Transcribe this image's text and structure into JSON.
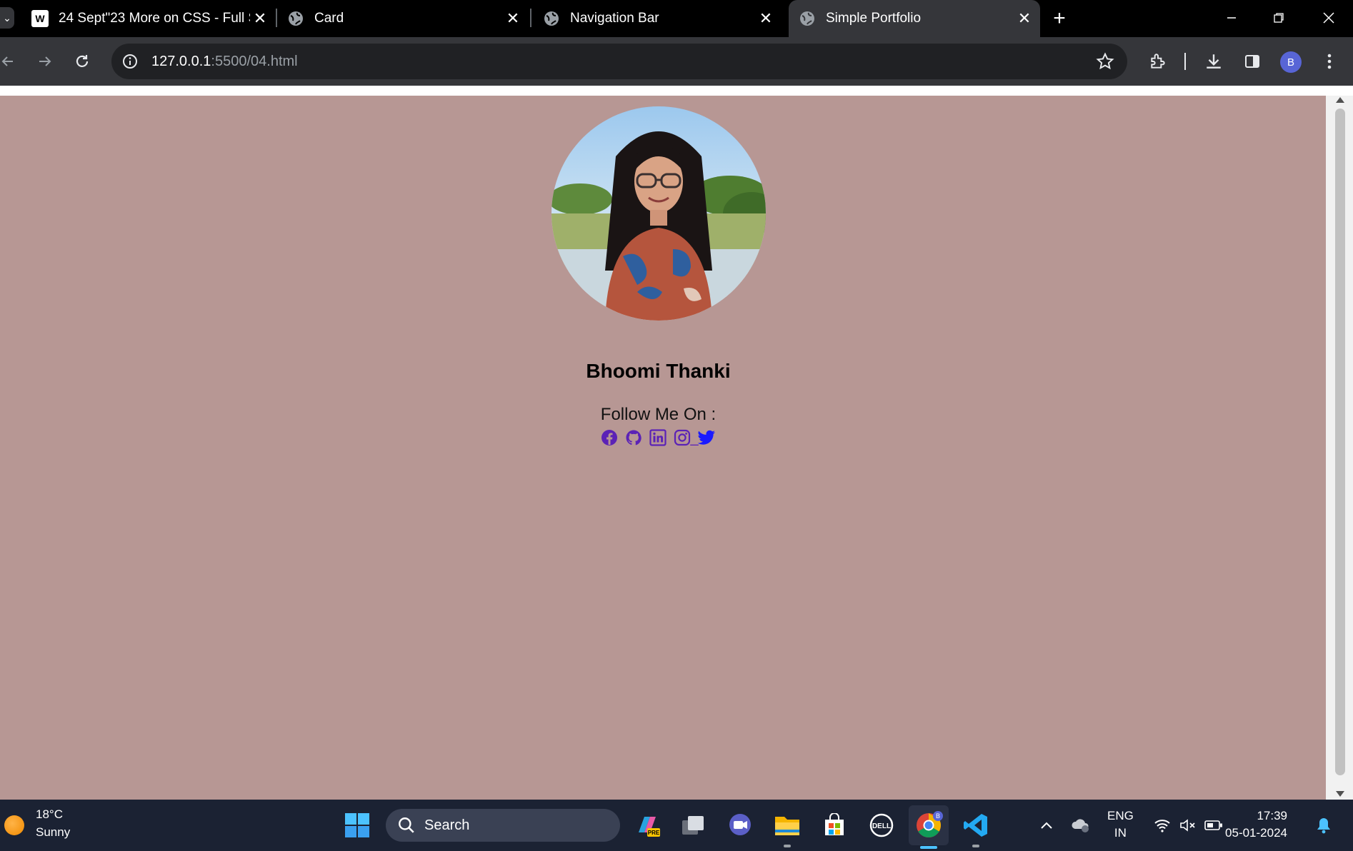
{
  "browser": {
    "tabs": [
      {
        "title": "24 Sept\"23 More on CSS - Full S",
        "active": false
      },
      {
        "title": "Card",
        "active": false
      },
      {
        "title": "Navigation Bar",
        "active": false
      },
      {
        "title": "Simple Portfolio",
        "active": true
      }
    ],
    "new_tab": "+",
    "close_glyph": "✕",
    "address": {
      "host": "127.0.0.1",
      "path": ":5500/04.html"
    },
    "profile_initial": "B"
  },
  "page": {
    "background": "#b79794",
    "name": "Bhoomi Thanki",
    "follow_label": "Follow Me On :",
    "social_icons": [
      "facebook-icon",
      "github-icon",
      "linkedin-icon",
      "instagram-icon",
      "twitter-icon"
    ],
    "social_separator": "_",
    "icon_color": "#5b22b6",
    "twitter_color": "#1a1aff"
  },
  "taskbar": {
    "weather_temp": "18°C",
    "weather_desc": "Sunny",
    "search_placeholder": "Search",
    "lang_top": "ENG",
    "lang_bottom": "IN",
    "time": "17:39",
    "date": "05-01-2024"
  }
}
